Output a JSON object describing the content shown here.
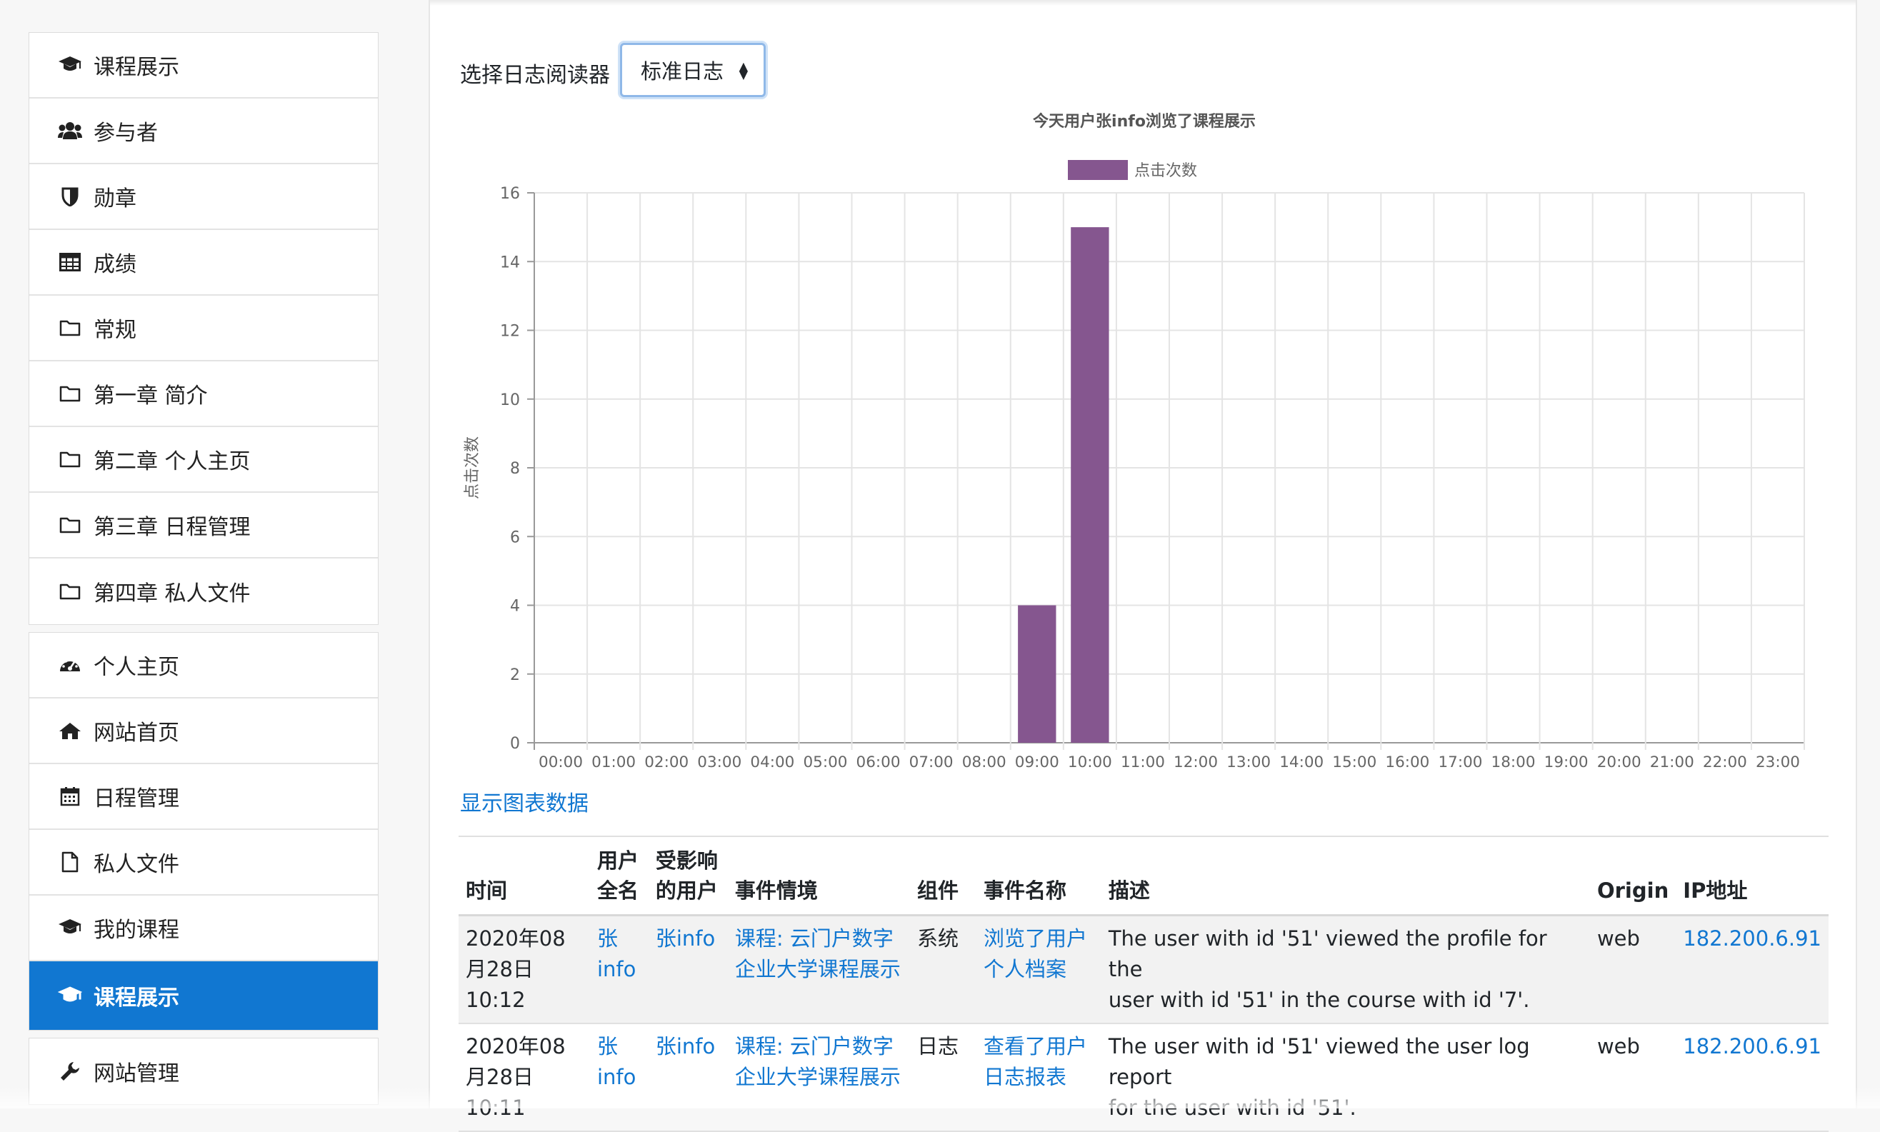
{
  "sidebar": {
    "course_items": [
      {
        "label": "课程展示",
        "icon": "graduation-cap-icon"
      },
      {
        "label": "参与者",
        "icon": "users-icon"
      },
      {
        "label": "勋章",
        "icon": "shield-icon"
      },
      {
        "label": "成绩",
        "icon": "table-icon"
      },
      {
        "label": "常规",
        "icon": "folder-icon"
      },
      {
        "label": "第一章 简介",
        "icon": "folder-icon"
      },
      {
        "label": "第二章 个人主页",
        "icon": "folder-icon"
      },
      {
        "label": "第三章 日程管理",
        "icon": "folder-icon"
      },
      {
        "label": "第四章 私人文件",
        "icon": "folder-icon"
      }
    ],
    "site_items": [
      {
        "label": "个人主页",
        "icon": "dashboard-icon"
      },
      {
        "label": "网站首页",
        "icon": "home-icon"
      },
      {
        "label": "日程管理",
        "icon": "calendar-icon"
      },
      {
        "label": "私人文件",
        "icon": "file-icon"
      },
      {
        "label": "我的课程",
        "icon": "graduation-cap-icon"
      },
      {
        "label": "课程展示",
        "icon": "graduation-cap-icon",
        "active": true
      }
    ],
    "admin_items": [
      {
        "label": "网站管理",
        "icon": "wrench-icon"
      }
    ],
    "accent_color": "#1177d1"
  },
  "reader": {
    "label": "选择日志阅读器",
    "selected": "标准日志"
  },
  "chart_data": {
    "type": "bar",
    "title": "今天用户张info浏览了课程展示",
    "ylabel": "点击次数",
    "xlabel": "",
    "legend_position": "top-center",
    "ylim": [
      0,
      16
    ],
    "yticks": [
      0,
      2,
      4,
      6,
      8,
      10,
      12,
      14,
      16
    ],
    "grid": true,
    "categories": [
      "00:00",
      "01:00",
      "02:00",
      "03:00",
      "04:00",
      "05:00",
      "06:00",
      "07:00",
      "08:00",
      "09:00",
      "10:00",
      "11:00",
      "12:00",
      "13:00",
      "14:00",
      "15:00",
      "16:00",
      "17:00",
      "18:00",
      "19:00",
      "20:00",
      "21:00",
      "22:00",
      "23:00"
    ],
    "series": [
      {
        "name": "点击次数",
        "color": "#85568f",
        "values": [
          0,
          0,
          0,
          0,
          0,
          0,
          0,
          0,
          0,
          4,
          15,
          0,
          0,
          0,
          0,
          0,
          0,
          0,
          0,
          0,
          0,
          0,
          0,
          0
        ]
      }
    ]
  },
  "show_chart_data": "显示图表数据",
  "table": {
    "headers": [
      {
        "line1": "",
        "line2": "时间"
      },
      {
        "line1": "用户",
        "line2": "全名"
      },
      {
        "line1": "受影响",
        "line2": "的用户"
      },
      {
        "line1": "",
        "line2": "事件情境"
      },
      {
        "line1": "",
        "line2": "组件"
      },
      {
        "line1": "",
        "line2": "事件名称"
      },
      {
        "line1": "",
        "line2": "描述"
      },
      {
        "line1": "",
        "line2": "Origin"
      },
      {
        "line1": "",
        "line2": "IP地址"
      }
    ],
    "rows": [
      {
        "time_a": "2020年08",
        "time_b": "月28日",
        "time_c": "10:12",
        "user_a": "张",
        "user_b": "info",
        "affected": "张info",
        "context_a": "课程: 云门户数字",
        "context_b": "企业大学课程展示",
        "component": "系统",
        "event_a": "浏览了用户",
        "event_b": "个人档案",
        "desc_a": "The user with id '51' viewed the profile for the",
        "desc_b": "user with id '51' in the course with id '7'.",
        "origin": "web",
        "ip": "182.200.6.91"
      },
      {
        "time_a": "2020年08",
        "time_b": "月28日",
        "time_c": "10:11",
        "user_a": "张",
        "user_b": "info",
        "affected": "张info",
        "context_a": "课程: 云门户数字",
        "context_b": "企业大学课程展示",
        "component": "日志",
        "event_a": "查看了用户",
        "event_b": "日志报表",
        "desc_a": "The user with id '51' viewed the user log report",
        "desc_b": "for the user with id '51'.",
        "origin": "web",
        "ip": "182.200.6.91"
      }
    ]
  }
}
